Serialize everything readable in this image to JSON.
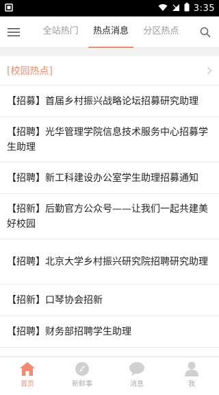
{
  "status_bar": {
    "time": "3:35"
  },
  "header": {
    "tabs": [
      {
        "label": "全站热门"
      },
      {
        "label": "热点消息"
      },
      {
        "label": "分区热点"
      }
    ],
    "active_tab": 1
  },
  "section": {
    "title": "[校园热点]"
  },
  "news": [
    {
      "title": "【招募】首届乡村振兴战略论坛招募研究助理"
    },
    {
      "title": "【招聘】光华管理学院信息技术服务中心招募学生助理"
    },
    {
      "title": "【招聘】新工科建设办公室学生助理招募通知"
    },
    {
      "title": "【招新】后勤官方公众号——让我们一起共建美好校园"
    },
    {
      "title": "【招聘】北京大学乡村振兴研究院招聘研究助理"
    },
    {
      "title": "【招新】口琴协会招新"
    },
    {
      "title": "【招聘】财务部招聘学生助理"
    }
  ],
  "tabbar": {
    "items": [
      {
        "label": "首页",
        "icon": "home-icon"
      },
      {
        "label": "新鲜事",
        "icon": "compass-icon"
      },
      {
        "label": "消息",
        "icon": "chat-bubble-icon"
      },
      {
        "label": "我",
        "icon": "person-icon"
      }
    ],
    "active": 0
  },
  "colors": {
    "accent": "#f08c6c",
    "inactive_icon": "#d0d0d0",
    "status_bar": "#000000"
  }
}
